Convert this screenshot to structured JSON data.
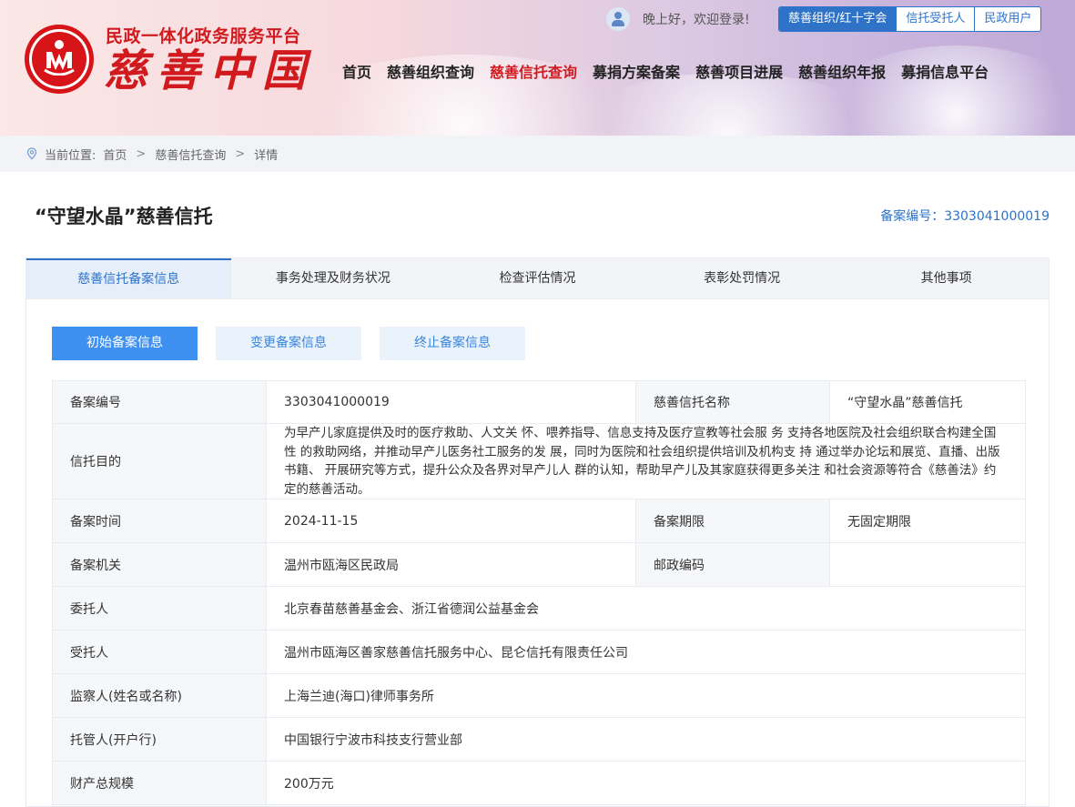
{
  "header": {
    "brand_top": "民政一体化政务服务平台",
    "brand_main": "慈善中国",
    "greeting": "晚上好，欢迎登录!",
    "role_tabs": [
      "慈善组织/红十字会",
      "信托受托人",
      "民政用户"
    ],
    "nav": [
      "首页",
      "慈善组织查询",
      "慈善信托查询",
      "募捐方案备案",
      "慈善项目进展",
      "慈善组织年报",
      "募捐信息平台"
    ],
    "active_nav": 2
  },
  "breadcrumb": {
    "prefix": "当前位置:",
    "items": [
      "首页",
      "慈善信托查询",
      "详情"
    ]
  },
  "title": "“守望水晶”慈善信托",
  "record_no_text": "备案编号：3303041000019",
  "tabs": [
    "慈善信托备案信息",
    "事务处理及财务状况",
    "检查评估情况",
    "表彰处罚情况",
    "其他事项"
  ],
  "sub_buttons": [
    "初始备案信息",
    "变更备案信息",
    "终止备案信息"
  ],
  "table": {
    "record_no_label": "备案编号",
    "record_no": "3303041000019",
    "trust_name_label": "慈善信托名称",
    "trust_name": "“守望水晶”慈善信托",
    "purpose_label": "信托目的",
    "purpose": "为早产儿家庭提供及时的医疗救助、人文关 怀、喂养指导、信息支持及医疗宣教等社会服 务 支持各地医院及社会组织联合构建全国性 的救助网络，并推动早产儿医务社工服务的发 展，同时为医院和社会组织提供培训及机构支 持 通过举办论坛和展览、直播、出版书籍、 开展研究等方式，提升公众及各界对早产儿人 群的认知，帮助早产儿及其家庭获得更多关注 和社会资源等符合《慈善法》约定的慈善活动。",
    "date_label": "备案时间",
    "date": "2024-11-15",
    "term_label": "备案期限",
    "term": "无固定期限",
    "authority_label": "备案机关",
    "authority": "温州市瓯海区民政局",
    "postcode_label": "邮政编码",
    "postcode": "",
    "settlor_label": "委托人",
    "settlor": "北京春苗慈善基金会、浙江省德润公益基金会",
    "trustee_label": "受托人",
    "trustee": "温州市瓯海区善家慈善信托服务中心、昆仑信托有限责任公司",
    "supervisor_label": "监察人(姓名或名称)",
    "supervisor": "上海兰迪(海口)律师事务所",
    "custodian_label": "托管人(开户行)",
    "custodian": "中国银行宁波市科技支行营业部",
    "assets_label": "财产总规模",
    "assets": "200万元"
  },
  "colors": {
    "brand_red": "#d11a1e",
    "primary_blue": "#2f73c8",
    "button_blue": "#3d8ff0"
  }
}
